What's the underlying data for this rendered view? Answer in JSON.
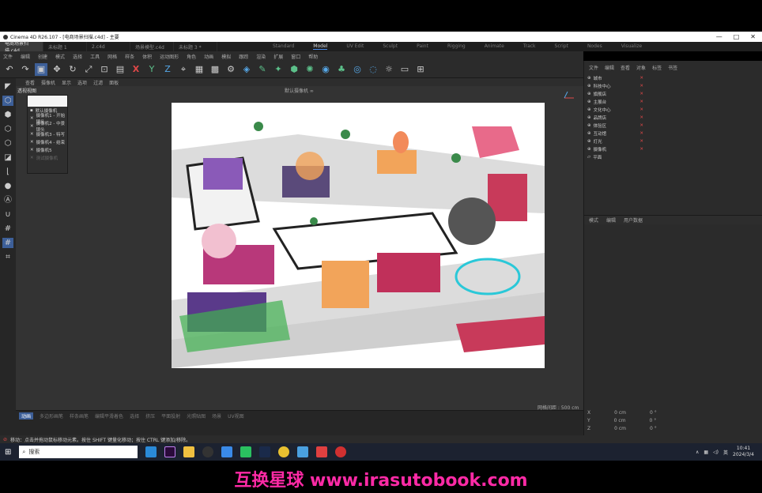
{
  "window": {
    "title": "Cinema 4D R26.107 - [电商场景扫描.c4d] - 主要",
    "controls": [
      "—",
      "□",
      "✕"
    ]
  },
  "doc_tabs": [
    "电商场景扫描.c4d",
    "未标题 1",
    "2.c4d",
    "场景模型.c4d",
    "未标题 3 *"
  ],
  "layouts": [
    "Standard",
    "Model",
    "UV Edit",
    "Sculpt",
    "Paint",
    "Rigging",
    "Animate",
    "Track",
    "Script",
    "Nodes",
    "Visualize"
  ],
  "active_layout": "Model",
  "menu": [
    "文件",
    "编辑",
    "创建",
    "模式",
    "选择",
    "工具",
    "网格",
    "样条",
    "体积",
    "运动图形",
    "角色",
    "动画",
    "模拟",
    "跟踪",
    "渲染",
    "扩展",
    "窗口",
    "帮助"
  ],
  "viewport_menu": [
    "查看",
    "摄像机",
    "显示",
    "选项",
    "过滤",
    "面板"
  ],
  "viewport": {
    "label": "透视视图",
    "camera_title": "默认摄像机 ∞",
    "grid_spacing": "网格间距 : 500 cm",
    "axes": {
      "x": "X",
      "y": "Y",
      "z": "Z"
    }
  },
  "dropdown": {
    "items": [
      "默认摄像机",
      "摄像机1 - 开始镜头",
      "摄像机2 - 中景镜头",
      "摄像机3 - 特写",
      "摄像机4 - 结束",
      "摄像机5",
      "测试摄像机"
    ]
  },
  "icons": {
    "undo": "undo-icon",
    "move": "move-icon",
    "rotate": "rotate-icon",
    "cube": "cube-icon",
    "light": "light-icon"
  },
  "object_manager": {
    "menu": [
      "文件",
      "编辑",
      "查看",
      "对象",
      "标签",
      "书签"
    ],
    "objects": [
      "城市",
      "科技中心",
      "旗舰店",
      "主展台",
      "文化中心",
      "品牌店",
      "体验区",
      "互动馆",
      "灯光",
      "摄像机",
      "平面"
    ]
  },
  "attributes": {
    "menu": [
      "模式",
      "编辑",
      "用户数据"
    ]
  },
  "coords": [
    {
      "axis": "X",
      "pos": "0 cm",
      "size": "0 °"
    },
    {
      "axis": "Y",
      "pos": "0 cm",
      "size": "0 °"
    },
    {
      "axis": "Z",
      "pos": "0 cm",
      "size": "0 °"
    }
  ],
  "timeline_tabs": [
    "动画",
    "多边形画笔",
    "样条画笔",
    "编辑平滑着色",
    "选择",
    "挤压",
    "平面投射",
    "光照贴图",
    "场景",
    "UV视图"
  ],
  "status_text": "移动：点击并拖动鼠标移动元素。按住 SHIFT 键量化移动；按住 CTRL 键添加/移除。",
  "taskbar": {
    "search_placeholder": "搜索",
    "time": "10:41",
    "date": "2024/3/4",
    "ime": "英"
  },
  "watermark": "互换星球 www.irasutobook.com",
  "colors": {
    "accent": "#3d5f98",
    "watermark": "#ff2aa6"
  }
}
